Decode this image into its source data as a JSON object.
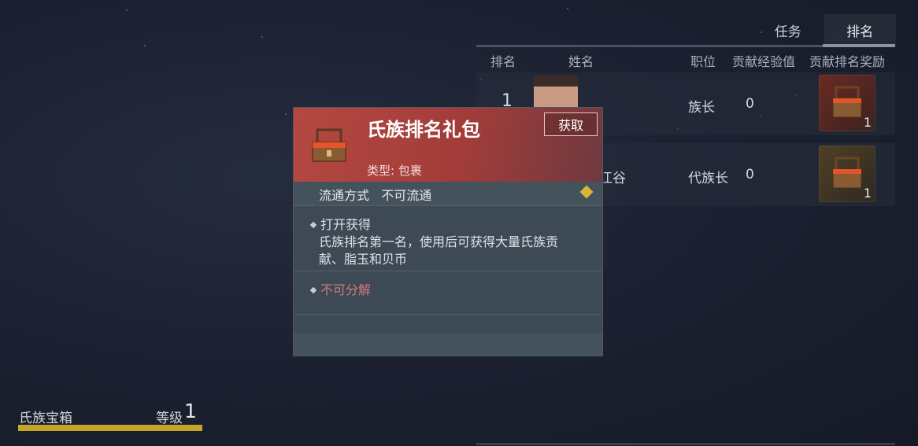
{
  "tabs": [
    {
      "label": "任务",
      "active": false
    },
    {
      "label": "排名",
      "active": true
    }
  ],
  "table": {
    "headers": [
      "排名",
      "姓名",
      "职位",
      "贡献经验值",
      "贡献排名奖励"
    ],
    "rows": [
      {
        "rank": "1",
        "name": "",
        "position": "族长",
        "contribution": "0",
        "reward_count": "1"
      },
      {
        "rank": "",
        "name": "江谷",
        "position": "代族长",
        "contribution": "0",
        "reward_count": "1"
      }
    ]
  },
  "tooltip": {
    "title": "氏族排名礼包",
    "button": "获取",
    "type": "类型: 包裹",
    "circulation_label": "流通方式",
    "circulation_value": "不可流通",
    "open_label": "打开获得",
    "description": "氏族排名第一名，使用后可获得大量氏族贡献、脂玉和贝币",
    "no_decompose": "不可分解"
  },
  "bottom": {
    "chest_label": "氏族宝箱",
    "level_label": "等级",
    "level_value": "1"
  },
  "colors": {
    "accent_gold": "#c4a52a",
    "tooltip_header": "#b44841",
    "warning_text": "#d07b7b"
  }
}
